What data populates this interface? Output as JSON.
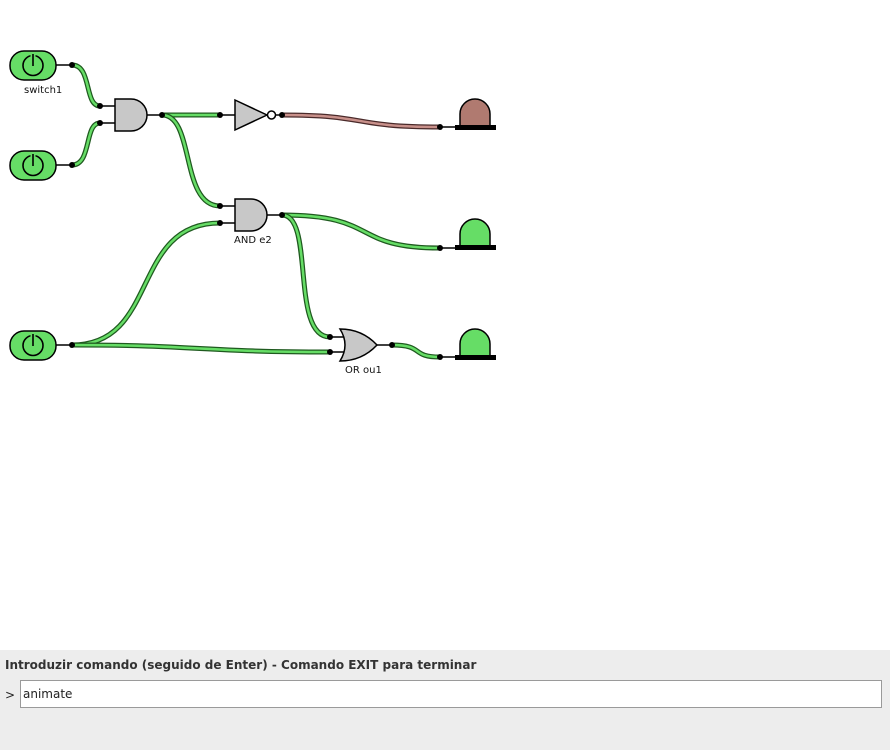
{
  "circuit": {
    "labels": {
      "switch1": "switch1",
      "and_e2": "AND e2",
      "or_ou1": "OR ou1"
    },
    "colors": {
      "switch_on": "#66dd66",
      "wire_on_outer": "#1f5a1f",
      "wire_on_inner": "#66dd66",
      "wire_off_outer": "#4a2a2a",
      "wire_off_inner": "#c8908a",
      "led_on": "#66dd66",
      "led_off": "#b07a70",
      "gate_fill": "#c8c8c8"
    },
    "components": {
      "switches": [
        {
          "id": "switch1",
          "state": "on",
          "icon": "power-icon"
        },
        {
          "id": "switch2",
          "state": "on",
          "icon": "power-icon"
        },
        {
          "id": "switch3",
          "state": "on",
          "icon": "power-icon"
        }
      ],
      "gates": [
        {
          "id": "and1",
          "type": "AND"
        },
        {
          "id": "not1",
          "type": "NOT"
        },
        {
          "id": "e2",
          "type": "AND"
        },
        {
          "id": "ou1",
          "type": "OR"
        }
      ],
      "leds": [
        {
          "id": "led1",
          "state": "off"
        },
        {
          "id": "led2",
          "state": "on"
        },
        {
          "id": "led3",
          "state": "on"
        }
      ]
    }
  },
  "console": {
    "instruction": "Introduzir comando (seguido de Enter) - Comando EXIT para terminar",
    "prompt_symbol": ">",
    "input_value": "animate"
  }
}
